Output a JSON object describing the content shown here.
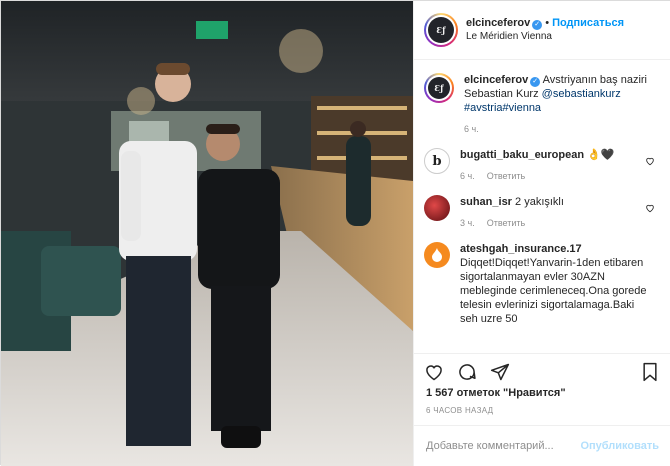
{
  "header": {
    "username": "elcinceferov",
    "dot": "•",
    "follow_label": "Подписаться",
    "location": "Le Méridien Vienna",
    "avatar_text": "Ɛƒ"
  },
  "caption": {
    "username": "elcinceferov",
    "text": "Avstriyanın baş naziri Sebastian Kurz",
    "mention": "@sebastiankurz",
    "hashtags": "#avstria#vienna",
    "time": "6 ч."
  },
  "comments": [
    {
      "username": "bugatti_baku_european",
      "text": "👌🖤",
      "time": "6 ч.",
      "reply": "Ответить"
    },
    {
      "username": "suhan_isr",
      "text": "2 yakışıklı",
      "time": "3 ч.",
      "reply": "Ответить"
    },
    {
      "username": "ateshgah_insurance.17",
      "text": "Diqqet!Diqqet!Yanvarin-1den etibaren sigortalanmayan evler 30AZN mebleginde cerimleneceq.Ona gorede telesin evlerinizi sigortalamaga.Baki seh uzre 50",
      "time": "",
      "reply": ""
    }
  ],
  "likes": "1 567 отметок \"Нравится\"",
  "timestamp": "6 ЧАСОВ НАЗАД",
  "add_comment": {
    "placeholder": "Добавьте комментарий...",
    "publish_label": "Опубликовать"
  },
  "colors": {
    "accent": "#0095f6",
    "muted": "#8e8e8e",
    "publish_disabled": "#b2dffc"
  }
}
